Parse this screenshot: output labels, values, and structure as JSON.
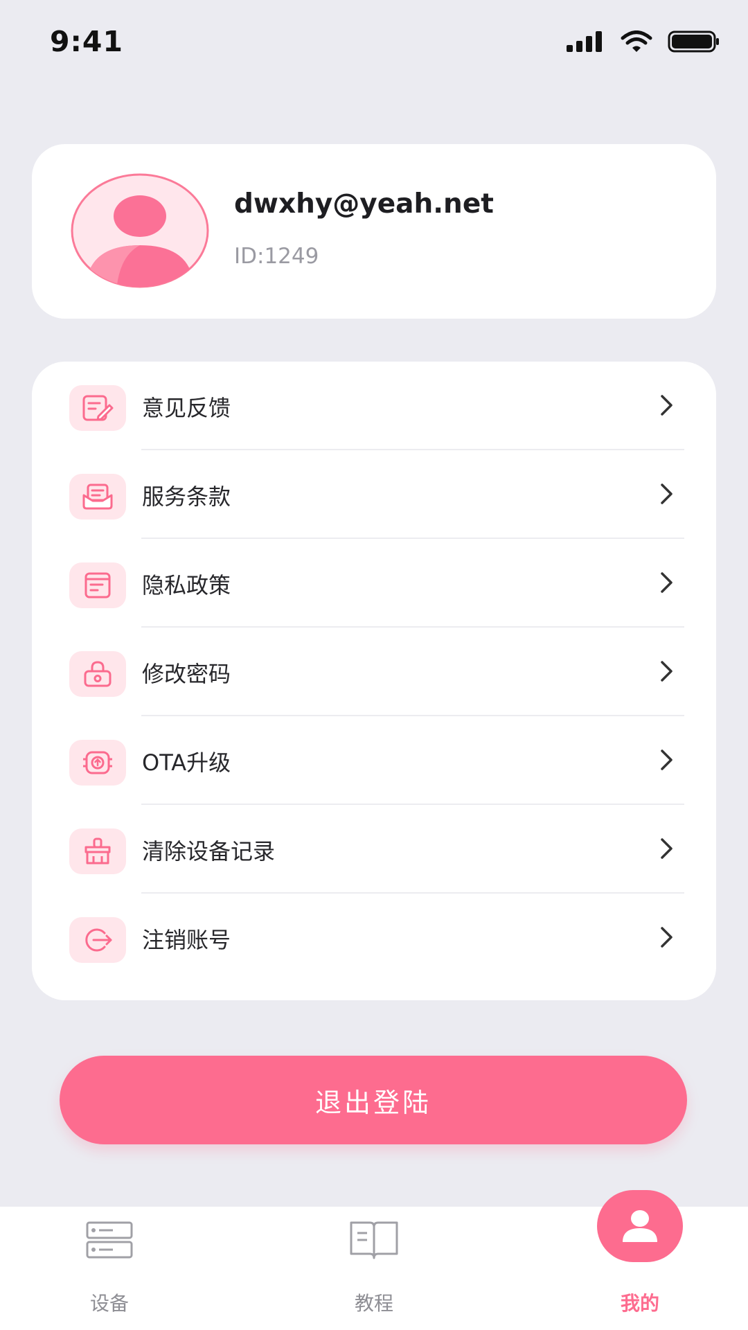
{
  "status_bar": {
    "time": "9:41"
  },
  "profile": {
    "email": "dwxhy@yeah.net",
    "id_text": "ID:1249"
  },
  "menu": {
    "items": [
      {
        "label": "意见反馈",
        "icon": "feedback-icon"
      },
      {
        "label": "服务条款",
        "icon": "terms-icon"
      },
      {
        "label": "隐私政策",
        "icon": "privacy-icon"
      },
      {
        "label": "修改密码",
        "icon": "lock-icon"
      },
      {
        "label": "OTA升级",
        "icon": "ota-upgrade-icon"
      },
      {
        "label": "清除设备记录",
        "icon": "broom-icon"
      },
      {
        "label": "注销账号",
        "icon": "logout-arrow-icon"
      }
    ]
  },
  "logout_button": {
    "label": "退出登陆"
  },
  "tab_bar": {
    "tabs": [
      {
        "label": "设备",
        "icon": "device-list-icon",
        "active": false
      },
      {
        "label": "教程",
        "icon": "book-icon",
        "active": false
      },
      {
        "label": "我的",
        "icon": "person-icon",
        "active": true
      }
    ]
  },
  "colors": {
    "accent": "#fd6c8f",
    "icon_bg": "#ffe6eb",
    "background": "#ebebf1"
  }
}
